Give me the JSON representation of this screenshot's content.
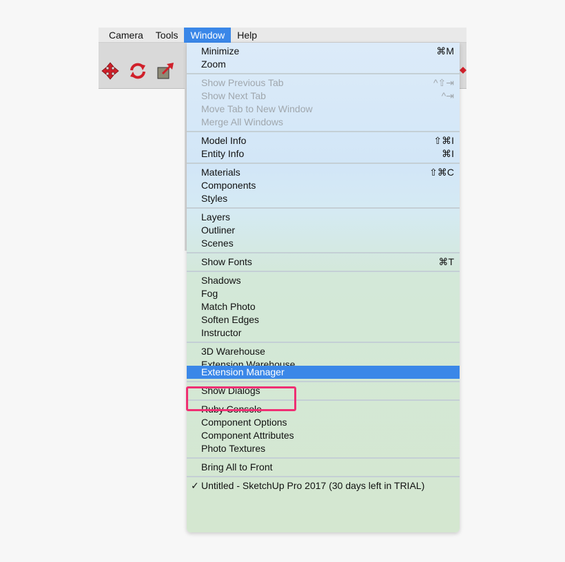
{
  "menubar": {
    "items": [
      {
        "label": "Camera"
      },
      {
        "label": "Tools"
      },
      {
        "label": "Window"
      },
      {
        "label": "Help"
      }
    ]
  },
  "toolbar": {
    "icons": [
      "move-icon",
      "rotate-icon",
      "scale-icon"
    ],
    "accent": "#d0202a"
  },
  "window_menu": {
    "sections": [
      [
        {
          "label": "Minimize",
          "shortcut": "⌘M"
        },
        {
          "label": "Zoom",
          "shortcut": ""
        }
      ],
      [
        {
          "label": "Show Previous Tab",
          "shortcut": "^⇧⇥",
          "disabled": true
        },
        {
          "label": "Show Next Tab",
          "shortcut": "^⇥",
          "disabled": true
        },
        {
          "label": "Move Tab to New Window",
          "shortcut": "",
          "disabled": true
        },
        {
          "label": "Merge All Windows",
          "shortcut": "",
          "disabled": true
        }
      ],
      [
        {
          "label": "Model Info",
          "shortcut": "⇧⌘I"
        },
        {
          "label": "Entity Info",
          "shortcut": "⌘I"
        }
      ],
      [
        {
          "label": "Materials",
          "shortcut": "⇧⌘C"
        },
        {
          "label": "Components",
          "shortcut": ""
        },
        {
          "label": "Styles",
          "shortcut": ""
        }
      ],
      [
        {
          "label": "Layers",
          "shortcut": ""
        },
        {
          "label": "Outliner",
          "shortcut": ""
        },
        {
          "label": "Scenes",
          "shortcut": ""
        }
      ],
      [
        {
          "label": "Show Fonts",
          "shortcut": "⌘T"
        }
      ],
      [
        {
          "label": "Shadows",
          "shortcut": ""
        },
        {
          "label": "Fog",
          "shortcut": ""
        },
        {
          "label": "Match Photo",
          "shortcut": ""
        },
        {
          "label": "Soften Edges",
          "shortcut": ""
        },
        {
          "label": "Instructor",
          "shortcut": ""
        }
      ],
      [
        {
          "label": "3D Warehouse",
          "shortcut": ""
        },
        {
          "label": "Extension Warehouse",
          "shortcut": ""
        },
        {
          "label": "Extension Manager",
          "shortcut": ""
        }
      ],
      [
        {
          "label": "Show Dialogs",
          "shortcut": ""
        }
      ],
      [
        {
          "label": "Ruby Console",
          "shortcut": ""
        },
        {
          "label": "Component Options",
          "shortcut": ""
        },
        {
          "label": "Component Attributes",
          "shortcut": ""
        },
        {
          "label": "Photo Textures",
          "shortcut": ""
        }
      ],
      [
        {
          "label": "Bring All to Front",
          "shortcut": ""
        }
      ],
      [
        {
          "label": "Untitled - SketchUp Pro 2017 (30 days left in TRIAL)",
          "shortcut": "",
          "checked": true,
          "check_mark": "✓"
        }
      ]
    ],
    "highlighted_item": "Extension Manager",
    "callout_color": "#ef2f73",
    "highlight_color": "#3a87e8"
  }
}
